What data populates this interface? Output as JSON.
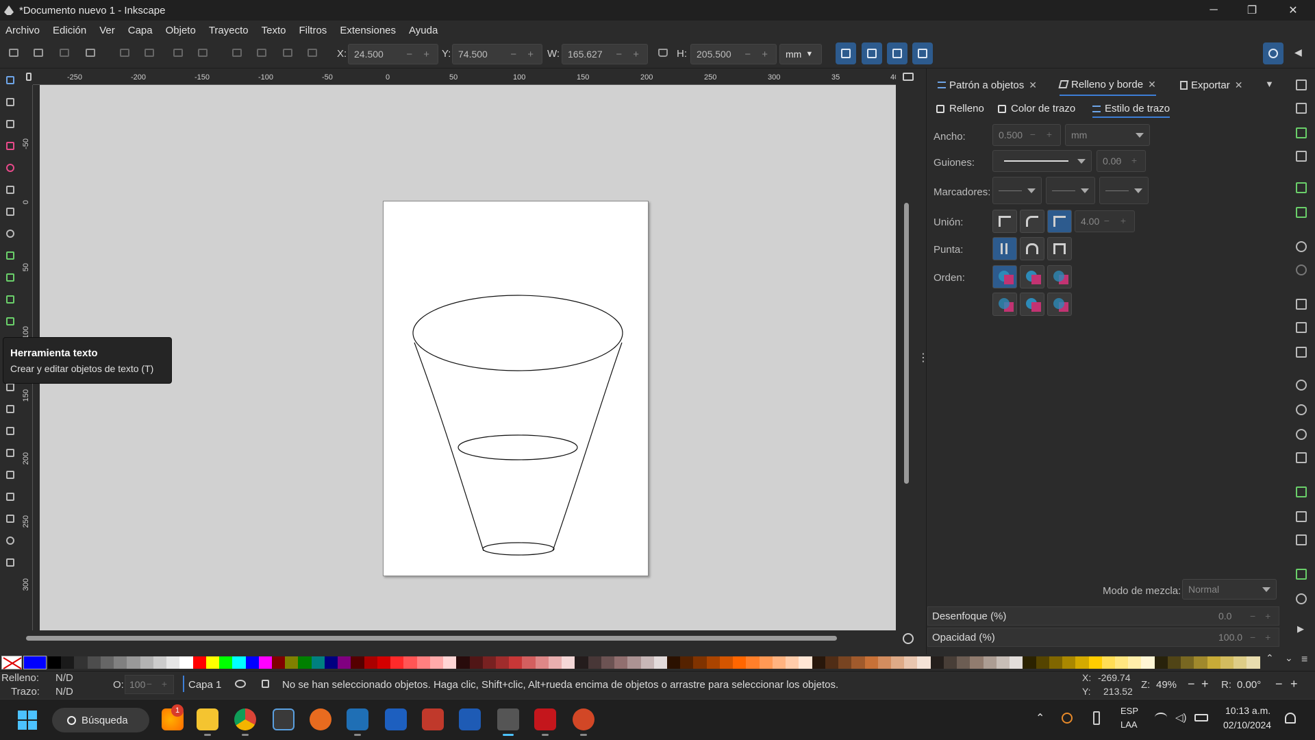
{
  "window": {
    "title": "*Documento nuevo 1 - Inkscape",
    "minimize": "─",
    "maximize": "❐",
    "close": "✕"
  },
  "menu": [
    "Archivo",
    "Edición",
    "Ver",
    "Capa",
    "Objeto",
    "Trayecto",
    "Texto",
    "Filtros",
    "Extensiones",
    "Ayuda"
  ],
  "toolbar": {
    "x_label": "X:",
    "x_value": "24.500",
    "y_label": "Y:",
    "y_value": "74.500",
    "w_label": "W:",
    "w_value": "165.627",
    "h_label": "H:",
    "h_value": "205.500",
    "unit": "mm",
    "spin_controls": "− +"
  },
  "ruler_top": [
    "-250",
    "-200",
    "-150",
    "-100",
    "-50",
    "0",
    "50",
    "100",
    "150",
    "200",
    "250",
    "300",
    "35",
    "40"
  ],
  "ruler_left": [
    "-50",
    "0",
    "50",
    "100",
    "150",
    "200",
    "250",
    "300"
  ],
  "tooltip": {
    "title": "Herramienta texto",
    "body": "Crear y editar objetos de texto (T)"
  },
  "dock": {
    "tabs": [
      "Patrón a objetos",
      "Relleno y borde",
      "Exportar"
    ],
    "tab_close": "✕",
    "subtabs": [
      "Relleno",
      "Color de trazo",
      "Estilo de trazo"
    ],
    "labels": {
      "ancho": "Ancho:",
      "guiones": "Guiones:",
      "marcadores": "Marcadores:",
      "union": "Unión:",
      "punta": "Punta:",
      "orden": "Orden:"
    },
    "ancho_value": "0.500",
    "ancho_unit": "mm",
    "dash_offset": "0.00",
    "miter_limit": "4.00",
    "blend_label": "Modo de mezcla:",
    "blend_value": "Normal",
    "blur_label": "Desenfoque (%)",
    "blur_value": "0.0",
    "opacity_label": "Opacidad (%)",
    "opacity_value": "100.0"
  },
  "status": {
    "fill_label": "Relleno:",
    "fill_value": "N/D",
    "stroke_label": "Trazo:",
    "stroke_value": "N/D",
    "o_label": "O:",
    "o_value": "100",
    "layer": "Capa 1",
    "message": "No se han seleccionado objetos. Haga clic, Shift+clic, Alt+rueda encima de objetos o arrastre para seleccionar los objetos.",
    "x_label": "X:",
    "x_coord": "-269.74",
    "y_label": "Y:",
    "y_coord": "213.52",
    "z_label": "Z:",
    "zoom": "49%",
    "r_label": "R:",
    "rotation": "0.00°"
  },
  "taskbar": {
    "search": "Búsqueda",
    "badge": "1",
    "lang1": "ESP",
    "lang2": "LAA",
    "time": "10:13 a.m.",
    "date": "02/10/2024"
  },
  "colors": {
    "accent": "#2d5b8e",
    "palette": [
      "#000000",
      "#1a1a1a",
      "#333333",
      "#4d4d4d",
      "#666666",
      "#808080",
      "#999999",
      "#b3b3b3",
      "#cccccc",
      "#e6e6e6",
      "#ffffff",
      "#ff0000",
      "#ffff00",
      "#00ff00",
      "#00ffff",
      "#0000ff",
      "#ff00ff",
      "#800000",
      "#808000",
      "#008000",
      "#008080",
      "#000080",
      "#800080",
      "#550000",
      "#aa0000",
      "#d40000",
      "#ff2a2a",
      "#ff5555",
      "#ff8080",
      "#ffaaaa",
      "#ffd5d5",
      "#280b0b",
      "#501616",
      "#782121",
      "#a02c2c",
      "#c83737",
      "#d35f5f",
      "#de8787",
      "#e9afaf",
      "#f4d7d7",
      "#241c1c",
      "#483737",
      "#6c5353",
      "#916f6f",
      "#ac9393",
      "#c8b7b7",
      "#e3dbdb",
      "#2b1100",
      "#552200",
      "#803300",
      "#aa4400",
      "#d45500",
      "#ff6600",
      "#ff7f2a",
      "#ff9955",
      "#ffb380",
      "#ffccaa",
      "#ffe6d5",
      "#28170b",
      "#502d16",
      "#784421",
      "#a05a2c",
      "#c87137",
      "#d38d5f",
      "#deaa87",
      "#e9c6af",
      "#f4e3d7",
      "#241f1c",
      "#483e37",
      "#6c5d53",
      "#917c6f",
      "#ac9d93",
      "#c8beb7",
      "#e3dedb",
      "#2b2200",
      "#554400",
      "#806600",
      "#aa8800",
      "#d4aa00",
      "#ffcc00",
      "#ffdd55",
      "#ffe680",
      "#ffeeaa",
      "#fff6d5",
      "#28220b",
      "#504416",
      "#786721",
      "#a0892c",
      "#c8ab37",
      "#d3bc5f",
      "#decd87",
      "#e9ddaf"
    ]
  }
}
